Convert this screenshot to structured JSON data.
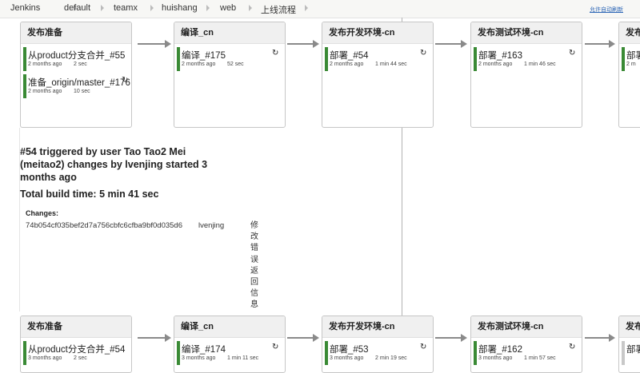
{
  "breadcrumb": [
    "Jenkins",
    "default",
    "teamx",
    "huishang",
    "web",
    "上线流程"
  ],
  "auto_refresh_label": "允许自动刷新",
  "pipelines": [
    {
      "stages": [
        {
          "title": "发布准备",
          "builds": [
            {
              "name": "从product分支合并_#55",
              "ago": "2 months ago",
              "duration": "2 sec",
              "color": "green"
            },
            {
              "name": "准备_origin/master_#176",
              "ago": "2 months ago",
              "duration": "10 sec",
              "color": "green",
              "refresh": true
            }
          ]
        },
        {
          "title": "编译_cn",
          "builds": [
            {
              "name": "编译_#175",
              "ago": "2 months ago",
              "duration": "52 sec",
              "color": "green",
              "refresh": true
            }
          ]
        },
        {
          "title": "发布开发环境-cn",
          "builds": [
            {
              "name": "部署_#54",
              "ago": "2 months ago",
              "duration": "1 min 44 sec",
              "color": "green",
              "refresh": true
            }
          ]
        },
        {
          "title": "发布测试环境-cn",
          "builds": [
            {
              "name": "部署_#163",
              "ago": "2 months ago",
              "duration": "1 min 46 sec",
              "color": "green",
              "refresh": true
            }
          ]
        },
        {
          "title": "发布",
          "builds": [
            {
              "name": "部署",
              "ago": "2 m",
              "duration": "",
              "color": "green"
            }
          ]
        }
      ]
    },
    {
      "stages": [
        {
          "title": "发布准备",
          "builds": [
            {
              "name": "从product分支合并_#54",
              "ago": "3 months ago",
              "duration": "2 sec",
              "color": "green"
            }
          ]
        },
        {
          "title": "编译_cn",
          "builds": [
            {
              "name": "编译_#174",
              "ago": "3 months ago",
              "duration": "1 min 11 sec",
              "color": "green",
              "refresh": true
            }
          ]
        },
        {
          "title": "发布开发环境-cn",
          "builds": [
            {
              "name": "部署_#53",
              "ago": "3 months ago",
              "duration": "2 min 19 sec",
              "color": "green",
              "refresh": true
            }
          ]
        },
        {
          "title": "发布测试环境-cn",
          "builds": [
            {
              "name": "部署_#162",
              "ago": "3 months ago",
              "duration": "1 min 57 sec",
              "color": "green",
              "refresh": true
            }
          ]
        },
        {
          "title": "发布",
          "builds": [
            {
              "name": "部署",
              "ago": "",
              "duration": "",
              "color": "grey"
            }
          ]
        }
      ]
    }
  ],
  "details": {
    "headline": "#54 triggered by user Tao Tao2 Mei (meitao2) changes by lvenjing started 3 months ago",
    "total_build_time": "Total build time: 5 min 41 sec",
    "changes_label": "Changes:",
    "changes": [
      {
        "commit": "74b054cf035bef2d7a756cbfc6cfba9bf0d035d6",
        "author": "lvenjing",
        "message": "修改错误返回信息"
      }
    ]
  },
  "icons": {
    "refresh": "refresh-icon",
    "separator": "chevron-right-icon"
  },
  "colors": {
    "success": "#3a8a35",
    "pending": "#c8c8c8",
    "link": "#2a64b5"
  }
}
